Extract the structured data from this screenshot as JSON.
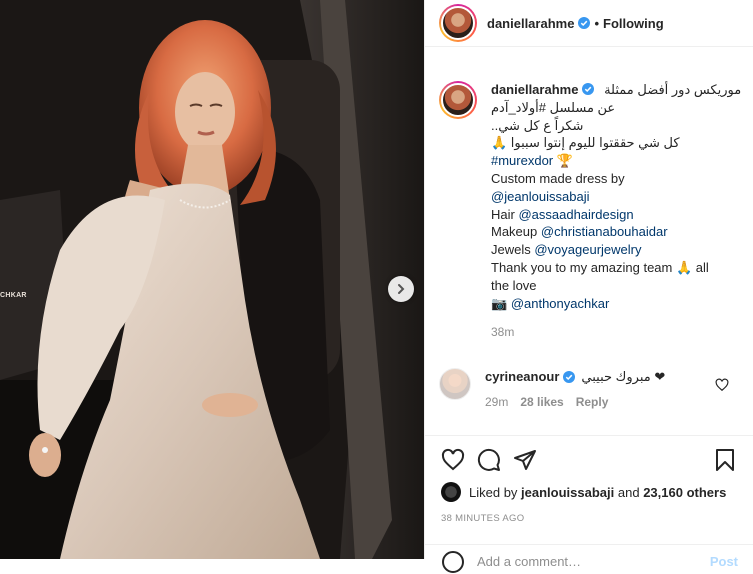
{
  "post": {
    "author": "daniellarahme",
    "follow_dot": "•",
    "follow_label": "Following",
    "photo_watermark": "CHKAR",
    "caption_lines": [
      {
        "text": "موريكس دور أفضل ممثلة",
        "rtl": true
      },
      {
        "text": "عن مسلسل #أولاد_آدم",
        "rtl": true
      },
      {
        "text": "شكراً ع كل شي..",
        "rtl": true
      },
      {
        "text": "كل شي حققتوا لليوم إنتوا سببوا 🙏",
        "rtl": true
      },
      {
        "text": "#murexdor 🏆",
        "rtl": false
      }
    ],
    "caption_en": [
      {
        "pre": "Custom made dress by",
        "link": ""
      },
      {
        "pre": "",
        "link": "@jeanlouissabaji"
      },
      {
        "pre": "Hair ",
        "link": "@assaadhairdesign"
      },
      {
        "pre": "Makeup ",
        "link": "@christianabouhaidar"
      },
      {
        "pre": "Jewels ",
        "link": "@voyageurjewelry"
      },
      {
        "pre": "Thank you to my amazing team 🙏 all",
        "link": ""
      },
      {
        "pre": "the love",
        "link": ""
      },
      {
        "pre": "📷 ",
        "link": "@anthonyachkar"
      }
    ],
    "caption_time": "38m"
  },
  "comment": {
    "username": "cyrineanour",
    "text": "مبروك حبيبي ❤",
    "time": "29m",
    "likes": "28 likes",
    "reply": "Reply"
  },
  "likes": {
    "liked_by_label": "Liked by",
    "liked_by_user": "jeanlouissabaji",
    "and_label": "and",
    "others": "23,160 others"
  },
  "post_time": "38 MINUTES AGO",
  "add_comment": {
    "placeholder": "Add a comment…",
    "post_label": "Post"
  },
  "colors": {
    "verified": "#3897f0",
    "link": "#00376b",
    "muted": "#8e8e8e"
  },
  "icons": [
    "chevron-right-icon",
    "verified-icon",
    "heart-icon",
    "comment-icon",
    "share-icon",
    "bookmark-icon",
    "emoji-icon"
  ]
}
